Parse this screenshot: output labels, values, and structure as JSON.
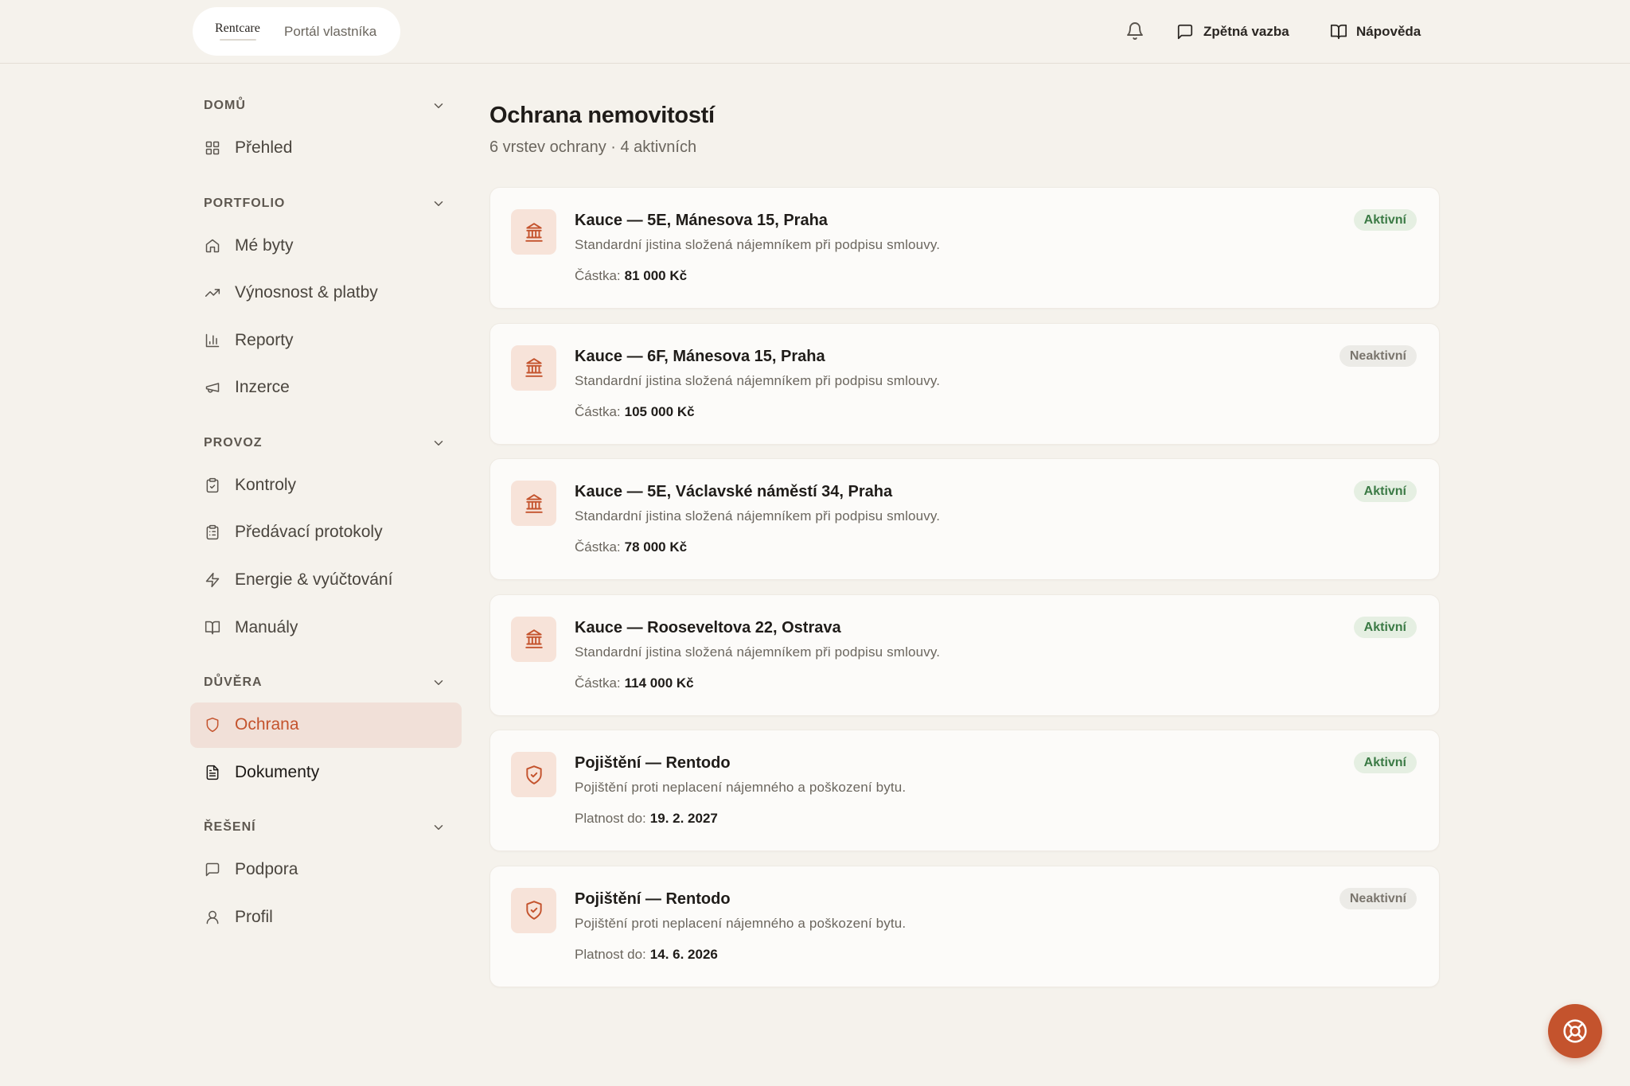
{
  "header": {
    "logo_text": "Rentcare",
    "portal_label": "Portál vlastníka",
    "feedback_label": "Zpětná vazba",
    "help_label": "Nápověda"
  },
  "sidebar": {
    "sections": [
      {
        "label": "DOMŮ",
        "items": [
          {
            "label": "Přehled",
            "icon": "layout-grid-icon"
          }
        ]
      },
      {
        "label": "PORTFOLIO",
        "items": [
          {
            "label": "Mé byty",
            "icon": "home-icon"
          },
          {
            "label": "Výnosnost & platby",
            "icon": "trending-up-icon"
          },
          {
            "label": "Reporty",
            "icon": "bar-chart-icon"
          },
          {
            "label": "Inzerce",
            "icon": "megaphone-icon"
          }
        ]
      },
      {
        "label": "PROVOZ",
        "items": [
          {
            "label": "Kontroly",
            "icon": "clipboard-check-icon"
          },
          {
            "label": "Předávací protokoly",
            "icon": "clipboard-list-icon"
          },
          {
            "label": "Energie & vyúčtování",
            "icon": "zap-icon"
          },
          {
            "label": "Manuály",
            "icon": "book-open-icon"
          }
        ]
      },
      {
        "label": "DŮVĚRA",
        "items": [
          {
            "label": "Ochrana",
            "icon": "shield-icon",
            "active": true
          },
          {
            "label": "Dokumenty",
            "icon": "file-text-icon",
            "hovered": true
          }
        ]
      },
      {
        "label": "ŘEŠENÍ",
        "items": [
          {
            "label": "Podpora",
            "icon": "message-square-icon"
          },
          {
            "label": "Profil",
            "icon": "user-icon"
          }
        ]
      }
    ]
  },
  "main": {
    "title": "Ochrana nemovitostí",
    "subtitle": "6 vrstev ochrany · 4 aktivních",
    "cards": [
      {
        "icon": "landmark-icon",
        "title": "Kauce — 5E, Mánesova 15, Praha",
        "description": "Standardní jistina složená nájemníkem při podpisu smlouvy.",
        "meta_label": "Částka:",
        "meta_value": "81 000 Kč",
        "status": "Aktivní",
        "active": true
      },
      {
        "icon": "landmark-icon",
        "title": "Kauce — 6F, Mánesova 15, Praha",
        "description": "Standardní jistina složená nájemníkem při podpisu smlouvy.",
        "meta_label": "Částka:",
        "meta_value": "105 000 Kč",
        "status": "Neaktivní",
        "active": false
      },
      {
        "icon": "landmark-icon",
        "title": "Kauce — 5E, Václavské náměstí 34, Praha",
        "description": "Standardní jistina složená nájemníkem při podpisu smlouvy.",
        "meta_label": "Částka:",
        "meta_value": "78 000 Kč",
        "status": "Aktivní",
        "active": true
      },
      {
        "icon": "landmark-icon",
        "title": "Kauce — Rooseveltova 22, Ostrava",
        "description": "Standardní jistina složená nájemníkem při podpisu smlouvy.",
        "meta_label": "Částka:",
        "meta_value": "114 000 Kč",
        "status": "Aktivní",
        "active": true
      },
      {
        "icon": "shield-check-icon",
        "title": "Pojištění — Rentodo",
        "description": "Pojištění proti neplacení nájemného a poškození bytu.",
        "meta_label": "Platnost do:",
        "meta_value": "19. 2. 2027",
        "status": "Aktivní",
        "active": true
      },
      {
        "icon": "shield-check-icon",
        "title": "Pojištění — Rentodo",
        "description": "Pojištění proti neplacení nájemného a poškození bytu.",
        "meta_label": "Platnost do:",
        "meta_value": "14. 6. 2026",
        "status": "Neaktivní",
        "active": false
      }
    ]
  },
  "colors": {
    "accent": "#c4532d",
    "background": "#f5f2ec",
    "active_status": "#3b7a45",
    "inactive_status": "#7a756d"
  }
}
